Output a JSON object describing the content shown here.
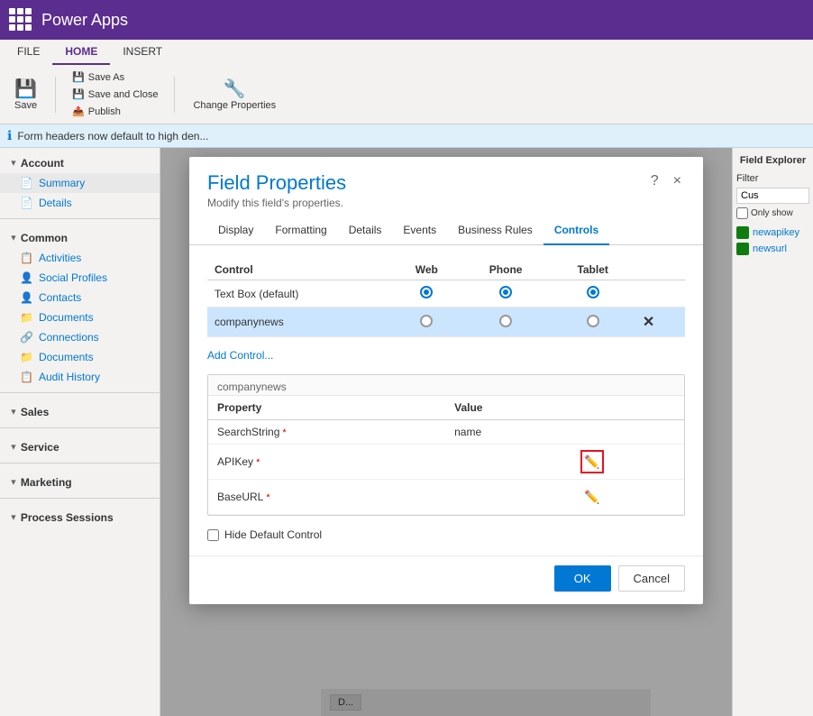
{
  "topbar": {
    "app_name": "Power Apps",
    "grid_icon": "apps-icon"
  },
  "ribbon": {
    "tabs": [
      "FILE",
      "HOME",
      "INSERT"
    ],
    "active_tab": "HOME",
    "buttons": {
      "save_label": "Save",
      "save_as_label": "Save As",
      "save_close_label": "Save and Close",
      "publish_label": "Publish",
      "change_props_label": "Change Properties"
    },
    "group_save_label": "Save"
  },
  "info_bar": {
    "message": "Form headers now default to high den..."
  },
  "sidebar": {
    "sections": [
      {
        "title": "Account",
        "items": [
          {
            "label": "Summary",
            "icon": "📄"
          },
          {
            "label": "Details",
            "icon": "📄"
          }
        ]
      },
      {
        "title": "Common",
        "items": [
          {
            "label": "Activities",
            "icon": "📋"
          },
          {
            "label": "Social Profiles",
            "icon": "👤"
          },
          {
            "label": "Contacts",
            "icon": "👤"
          },
          {
            "label": "Documents",
            "icon": "📁"
          },
          {
            "label": "Connections",
            "icon": "🔗"
          },
          {
            "label": "Documents",
            "icon": "📁"
          },
          {
            "label": "Audit History",
            "icon": "📋"
          }
        ]
      },
      {
        "title": "Sales",
        "items": []
      },
      {
        "title": "Service",
        "items": []
      },
      {
        "title": "Marketing",
        "items": []
      },
      {
        "title": "Process Sessions",
        "items": []
      }
    ]
  },
  "right_panel": {
    "title": "Field Explorer",
    "filter_label": "Filter",
    "filter_placeholder": "Cus",
    "only_show_label": "Only show",
    "items": [
      {
        "label": "newapikey"
      },
      {
        "label": "newsurl"
      }
    ]
  },
  "modal": {
    "title": "Field Properties",
    "subtitle": "Modify this field's properties.",
    "help_label": "?",
    "close_label": "×",
    "tabs": [
      "Display",
      "Formatting",
      "Details",
      "Events",
      "Business Rules",
      "Controls"
    ],
    "active_tab": "Controls",
    "controls_table": {
      "headers": [
        "Control",
        "Web",
        "Phone",
        "Tablet"
      ],
      "rows": [
        {
          "name": "Text Box (default)",
          "web": true,
          "phone": true,
          "tablet": true,
          "is_default": true,
          "highlighted": false
        },
        {
          "name": "companynews",
          "web": false,
          "phone": false,
          "tablet": false,
          "is_default": false,
          "highlighted": true,
          "has_delete": true
        }
      ]
    },
    "add_control_label": "Add Control...",
    "companynews_section": {
      "title": "companynews",
      "headers": [
        "Property",
        "Value"
      ],
      "rows": [
        {
          "property": "SearchString",
          "required": true,
          "value": "name",
          "has_edit": false,
          "edit_highlighted": false
        },
        {
          "property": "APIKey",
          "required": true,
          "value": "",
          "has_edit": true,
          "edit_highlighted": true
        },
        {
          "property": "BaseURL",
          "required": true,
          "value": "",
          "has_edit": true,
          "edit_highlighted": false
        }
      ]
    },
    "hide_default_label": "Hide Default Control",
    "footer": {
      "ok_label": "OK",
      "cancel_label": "Cancel"
    }
  },
  "bottom_bar": {
    "item_label": "D..."
  }
}
